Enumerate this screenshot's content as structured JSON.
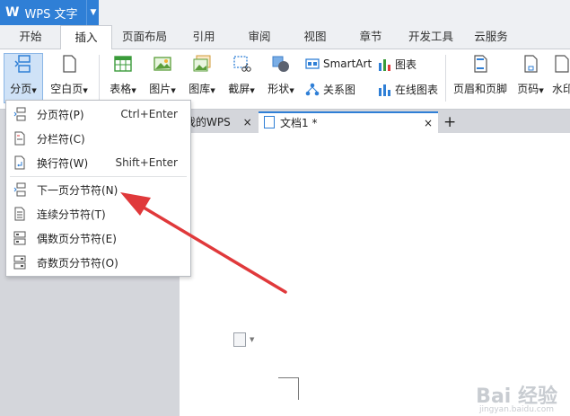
{
  "app": {
    "title": "WPS 文字",
    "logo": "W"
  },
  "tabs": [
    "开始",
    "插入",
    "页面布局",
    "引用",
    "审阅",
    "视图",
    "章节",
    "开发工具",
    "云服务"
  ],
  "active_tab": "插入",
  "ribbon": {
    "fenye": "分页",
    "kongbaiye": "空白页",
    "biaoge": "表格",
    "tupian": "图片",
    "tuku": "图库",
    "jieping": "截屏",
    "xingzhuang": "形状",
    "smartart": "SmartArt",
    "tubiao": "图表",
    "guanxitu": "关系图",
    "zaixiantubiao": "在线图表",
    "yemeiyejiao": "页眉和页脚",
    "yema": "页码",
    "shuiyin": "水印"
  },
  "doc_tabs": {
    "mywps": "我的WPS",
    "doc1": "文档1 *",
    "close": "×",
    "add": "+"
  },
  "menu": [
    {
      "label": "分页符(P)",
      "shortcut": "Ctrl+Enter"
    },
    {
      "label": "分栏符(C)",
      "shortcut": ""
    },
    {
      "label": "换行符(W)",
      "shortcut": "Shift+Enter"
    },
    {
      "label": "下一页分节符(N)",
      "shortcut": ""
    },
    {
      "label": "连续分节符(T)",
      "shortcut": ""
    },
    {
      "label": "偶数页分节符(E)",
      "shortcut": ""
    },
    {
      "label": "奇数页分节符(O)",
      "shortcut": ""
    }
  ],
  "watermark": {
    "main": "Bai 经验",
    "sub": "jingyan.baidu.com"
  },
  "colors": {
    "accent": "#2f7fd6",
    "arrow": "#e0393b"
  }
}
